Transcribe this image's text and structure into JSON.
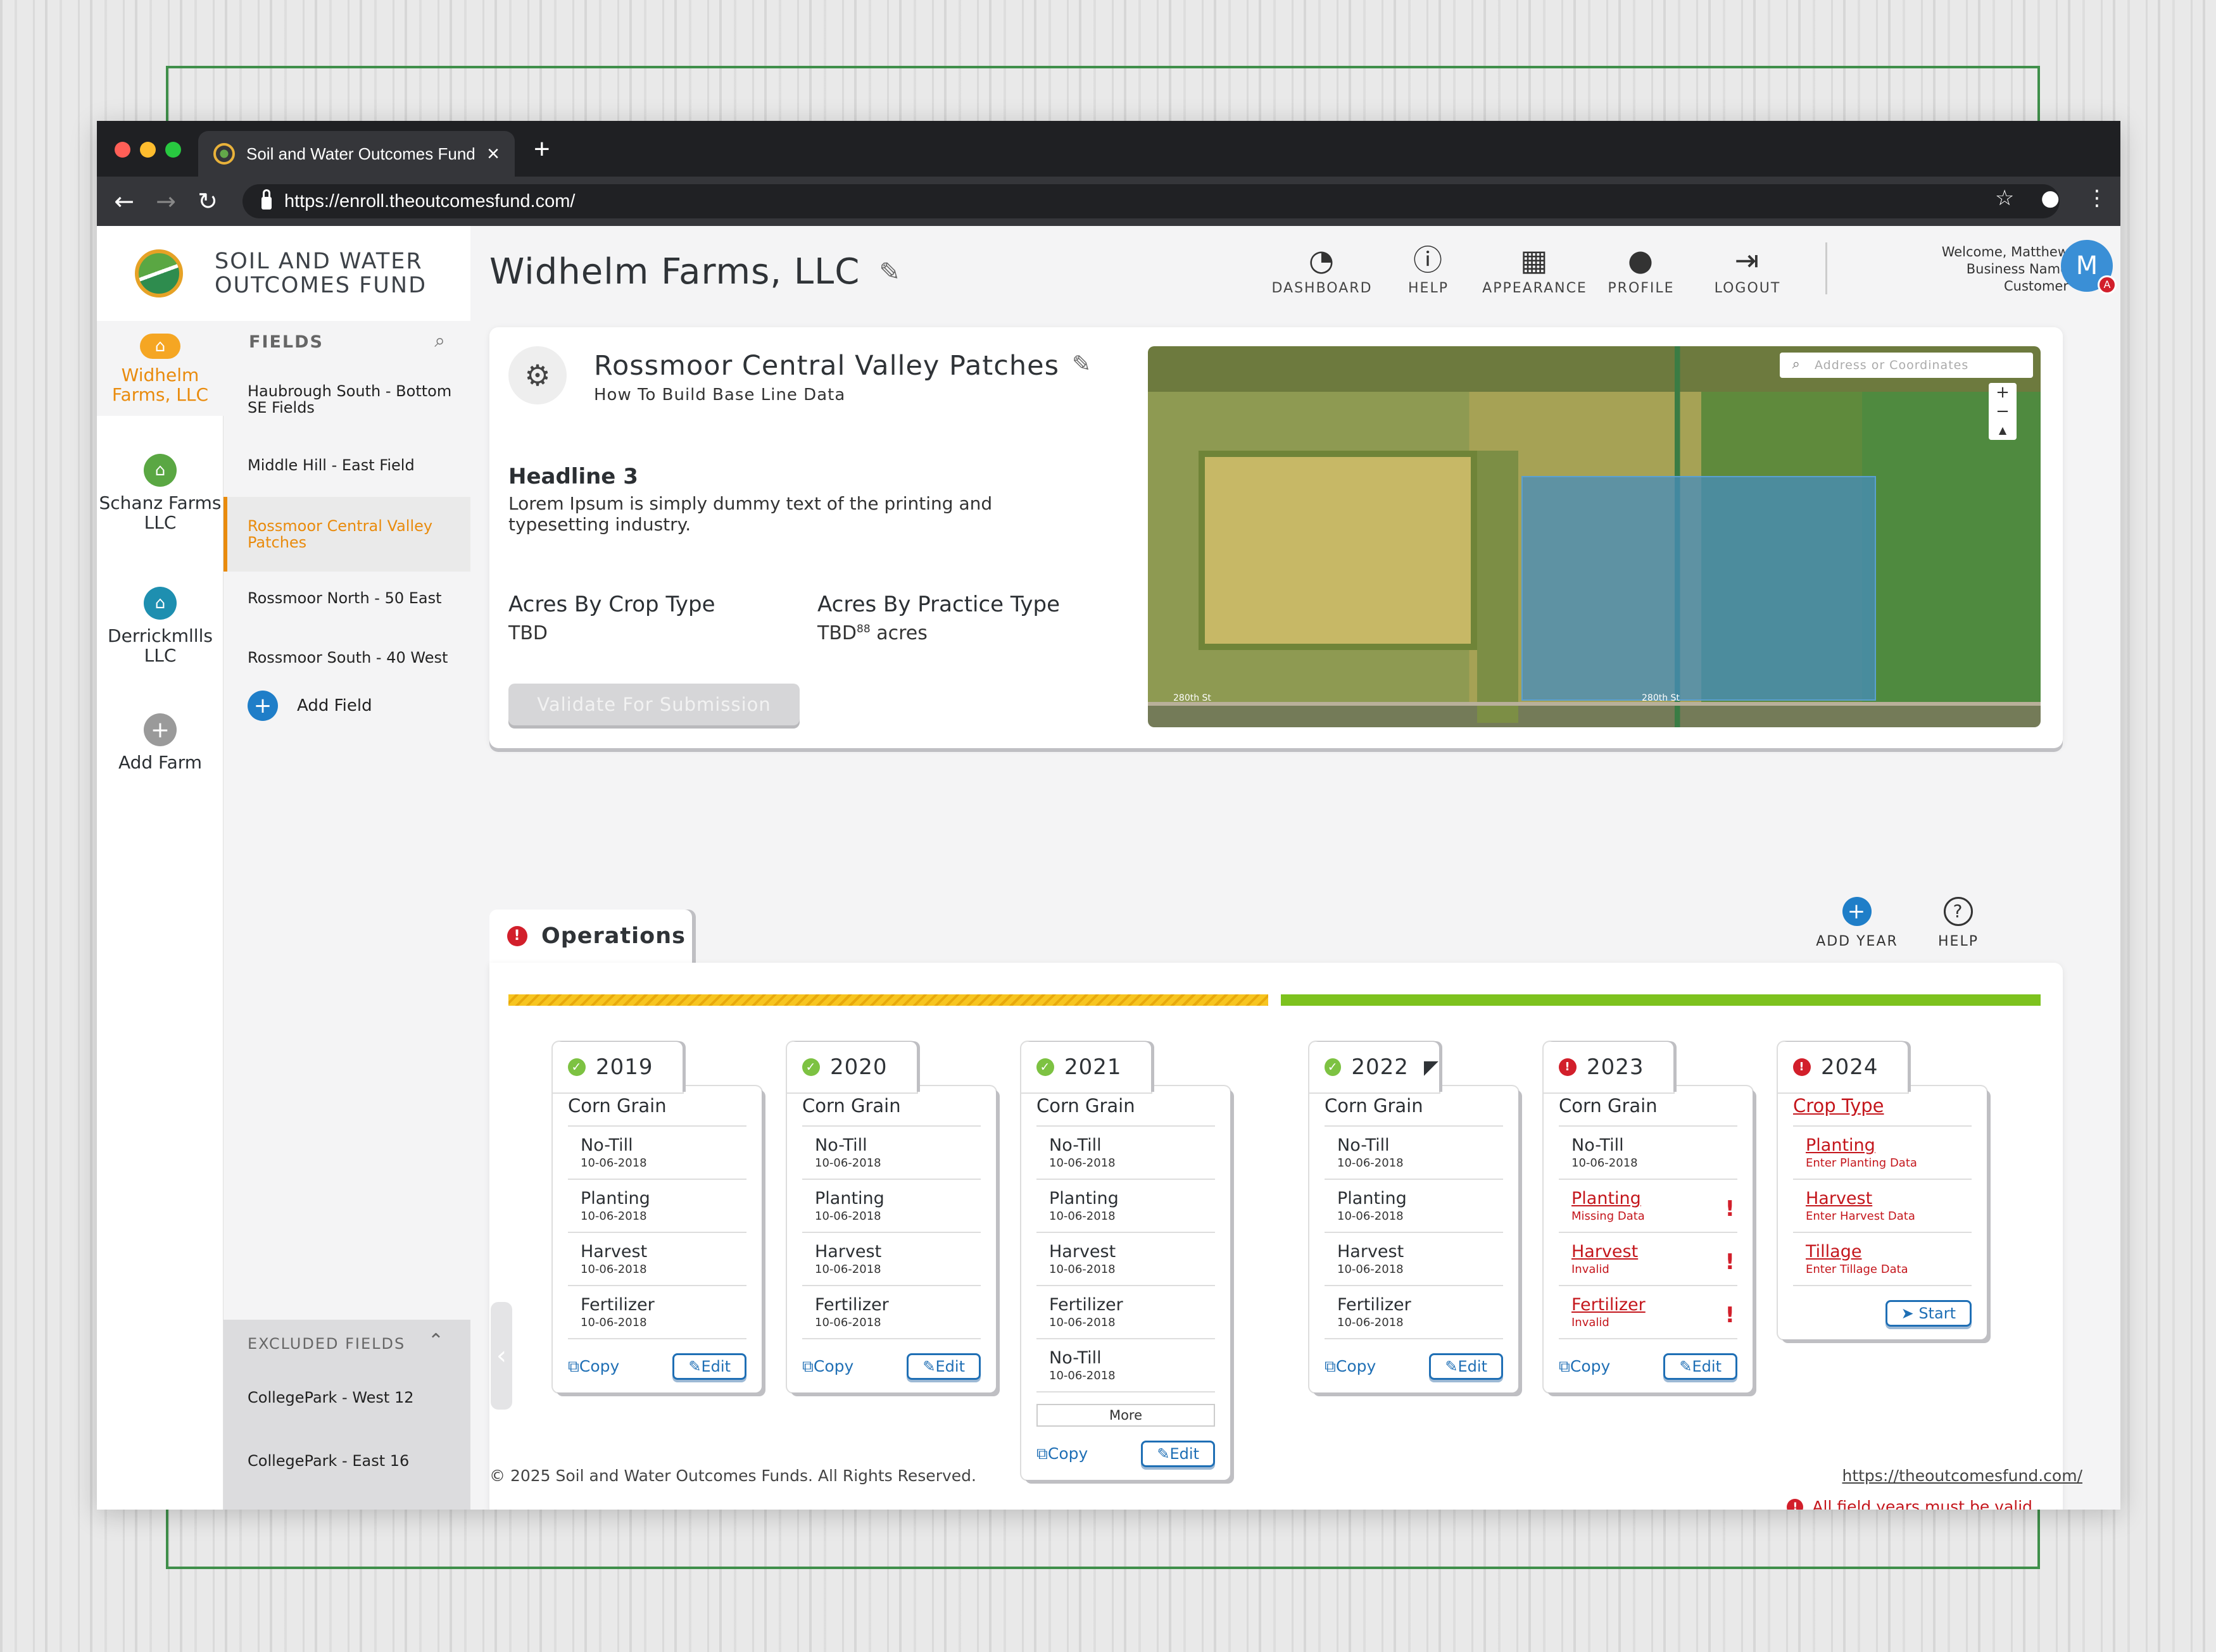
{
  "browser": {
    "tab_title": "Soil and Water Outcomes Fund",
    "url": "https://enroll.theoutcomesfund.com/",
    "icons": [
      "back-icon",
      "forward-icon",
      "reload-icon",
      "lock-icon",
      "star-icon",
      "account-icon",
      "menu-icon"
    ]
  },
  "brand": {
    "line1": "SOIL AND WATER",
    "line2": "OUTCOMES FUND"
  },
  "farms": [
    {
      "name": "Widhelm Farms, LLC",
      "color": "#f5a623",
      "active": true
    },
    {
      "name": "Schanz Farms LLC",
      "color": "#5aa743"
    },
    {
      "name": "Derrickmllls LLC",
      "color": "#1e8fb0"
    }
  ],
  "add_farm": "Add Farm",
  "fields": {
    "heading": "FIELDS",
    "items": [
      "Haubrough South - Bottom SE Fields",
      "Middle Hill - East Field",
      "Rossmoor Central Valley Patches",
      "Rossmoor North - 50 East",
      "Rossmoor South - 40 West"
    ],
    "add": "Add Field",
    "excluded_heading": "EXCLUDED FIELDS",
    "excluded": [
      "CollegePark - West 12",
      "CollegePark - East 16"
    ]
  },
  "page_title": "Widhelm Farms, LLC",
  "nav": [
    "DASHBOARD",
    "HELP",
    "APPEARANCE",
    "PROFILE",
    "LOGOUT"
  ],
  "user": {
    "line1": "Welcome, Matthew",
    "line2": "Business Name",
    "line3": "Customer",
    "initial": "M",
    "badge": "A"
  },
  "field_card": {
    "title": "Rossmoor Central Valley Patches",
    "subtitle": "How To Build Base Line Data",
    "headline": "Headline 3",
    "body": "Lorem Ipsum is simply dummy text of the printing and typesetting industry.",
    "crop_label": "Acres By Crop Type",
    "crop_value": "TBD",
    "practice_label": "Acres By Practice Type",
    "practice_value": "TBD",
    "practice_sup": "88",
    "practice_unit": "acres",
    "validate": "Validate For Submission"
  },
  "map": {
    "search_placeholder": "Address or Coordinates",
    "road1": "280th St",
    "road2": "280th St"
  },
  "operations": {
    "tab": "Operations",
    "add_year": "ADD YEAR",
    "help": "HELP",
    "footer_error": "All field years must be valid.",
    "progress": {
      "hatched_fraction": 0.5,
      "solid_fraction": 0.5,
      "hatched_color": "#f7c520",
      "solid_color": "#7dc21e"
    }
  },
  "years": [
    {
      "year": "2019",
      "status": "ok",
      "crop": "Corn Grain",
      "ops": [
        {
          "n": "No-Till",
          "d": "10-06-2018"
        },
        {
          "n": "Planting",
          "d": "10-06-2018"
        },
        {
          "n": "Harvest",
          "d": "10-06-2018"
        },
        {
          "n": "Fertilizer",
          "d": "10-06-2018"
        }
      ]
    },
    {
      "year": "2020",
      "status": "ok",
      "crop": "Corn Grain",
      "ops": [
        {
          "n": "No-Till",
          "d": "10-06-2018"
        },
        {
          "n": "Planting",
          "d": "10-06-2018"
        },
        {
          "n": "Harvest",
          "d": "10-06-2018"
        },
        {
          "n": "Fertilizer",
          "d": "10-06-2018"
        }
      ]
    },
    {
      "year": "2021",
      "status": "ok",
      "crop": "Corn Grain",
      "ops": [
        {
          "n": "No-Till",
          "d": "10-06-2018"
        },
        {
          "n": "Planting",
          "d": "10-06-2018"
        },
        {
          "n": "Harvest",
          "d": "10-06-2018"
        },
        {
          "n": "Fertilizer",
          "d": "10-06-2018"
        },
        {
          "n": "No-Till",
          "d": "10-06-2018"
        }
      ],
      "more": "More"
    },
    {
      "year": "2022",
      "status": "ok",
      "flag": true,
      "crop": "Corn Grain",
      "ops": [
        {
          "n": "No-Till",
          "d": "10-06-2018"
        },
        {
          "n": "Planting",
          "d": "10-06-2018"
        },
        {
          "n": "Harvest",
          "d": "10-06-2018"
        },
        {
          "n": "Fertilizer",
          "d": "10-06-2018"
        }
      ]
    },
    {
      "year": "2023",
      "status": "error",
      "crop": "Corn Grain",
      "ops": [
        {
          "n": "No-Till",
          "d": "10-06-2018"
        },
        {
          "n": "Planting",
          "d": "Missing Data",
          "err": true
        },
        {
          "n": "Harvest",
          "d": "Invalid",
          "err": true
        },
        {
          "n": "Fertilizer",
          "d": "Invalid",
          "err": true
        }
      ]
    },
    {
      "year": "2024",
      "status": "error",
      "crop": "Crop Type",
      "crop_err": true,
      "ops": [
        {
          "n": "Planting",
          "d": "Enter Planting Data",
          "err": true
        },
        {
          "n": "Harvest",
          "d": "Enter Harvest Data",
          "err": true
        },
        {
          "n": "Tillage",
          "d": "Enter Tillage Data",
          "err": true
        }
      ],
      "start": "Start"
    }
  ],
  "labels": {
    "copy": "Copy",
    "edit": "Edit"
  },
  "footer": {
    "copyright": "© 2025 Soil and Water Outcomes Funds. All Rights Reserved.",
    "link": "https://theoutcomesfund.com/"
  }
}
